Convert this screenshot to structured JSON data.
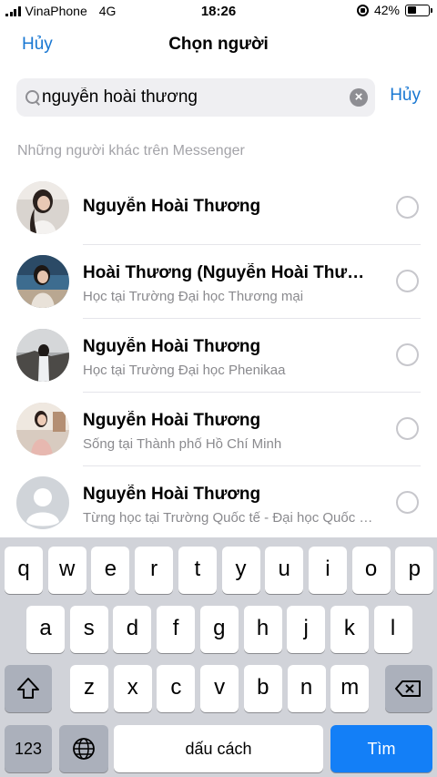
{
  "status_bar": {
    "carrier": "VinaPhone",
    "network": "4G",
    "time": "18:26",
    "battery_percent": "42%",
    "battery_level": 0.42
  },
  "nav": {
    "cancel_label": "Hủy",
    "title": "Chọn người"
  },
  "search": {
    "value": "nguyễn hoài thương",
    "cancel_label": "Hủy",
    "clear_icon": "×"
  },
  "section_header": "Những người khác trên Messenger",
  "results": [
    {
      "name": "Nguyễn Hoài Thương",
      "subtitle": ""
    },
    {
      "name": "Hoài Thương (Nguyễn Hoài Thương)",
      "subtitle": "Học tại Trường Đại học Thương mại"
    },
    {
      "name": "Nguyễn Hoài Thương",
      "subtitle": "Học tại Trường Đại học Phenikaa"
    },
    {
      "name": "Nguyễn Hoài Thương",
      "subtitle": "Sống tại Thành phố Hồ Chí Minh"
    },
    {
      "name": "Nguyễn Hoài Thương",
      "subtitle": "Từng học tại Trường Quốc tế - Đại học Quốc gia Hà Nội"
    }
  ],
  "keyboard": {
    "row1": [
      "q",
      "w",
      "e",
      "r",
      "t",
      "y",
      "u",
      "i",
      "o",
      "p"
    ],
    "row2": [
      "a",
      "s",
      "d",
      "f",
      "g",
      "h",
      "j",
      "k",
      "l"
    ],
    "row3": [
      "z",
      "x",
      "c",
      "v",
      "b",
      "n",
      "m"
    ],
    "numbers_label": "123",
    "space_label": "dấu cách",
    "return_label": "Tìm"
  },
  "colors": {
    "accent": "#1877d2",
    "keyboard_return": "#137ff7"
  }
}
